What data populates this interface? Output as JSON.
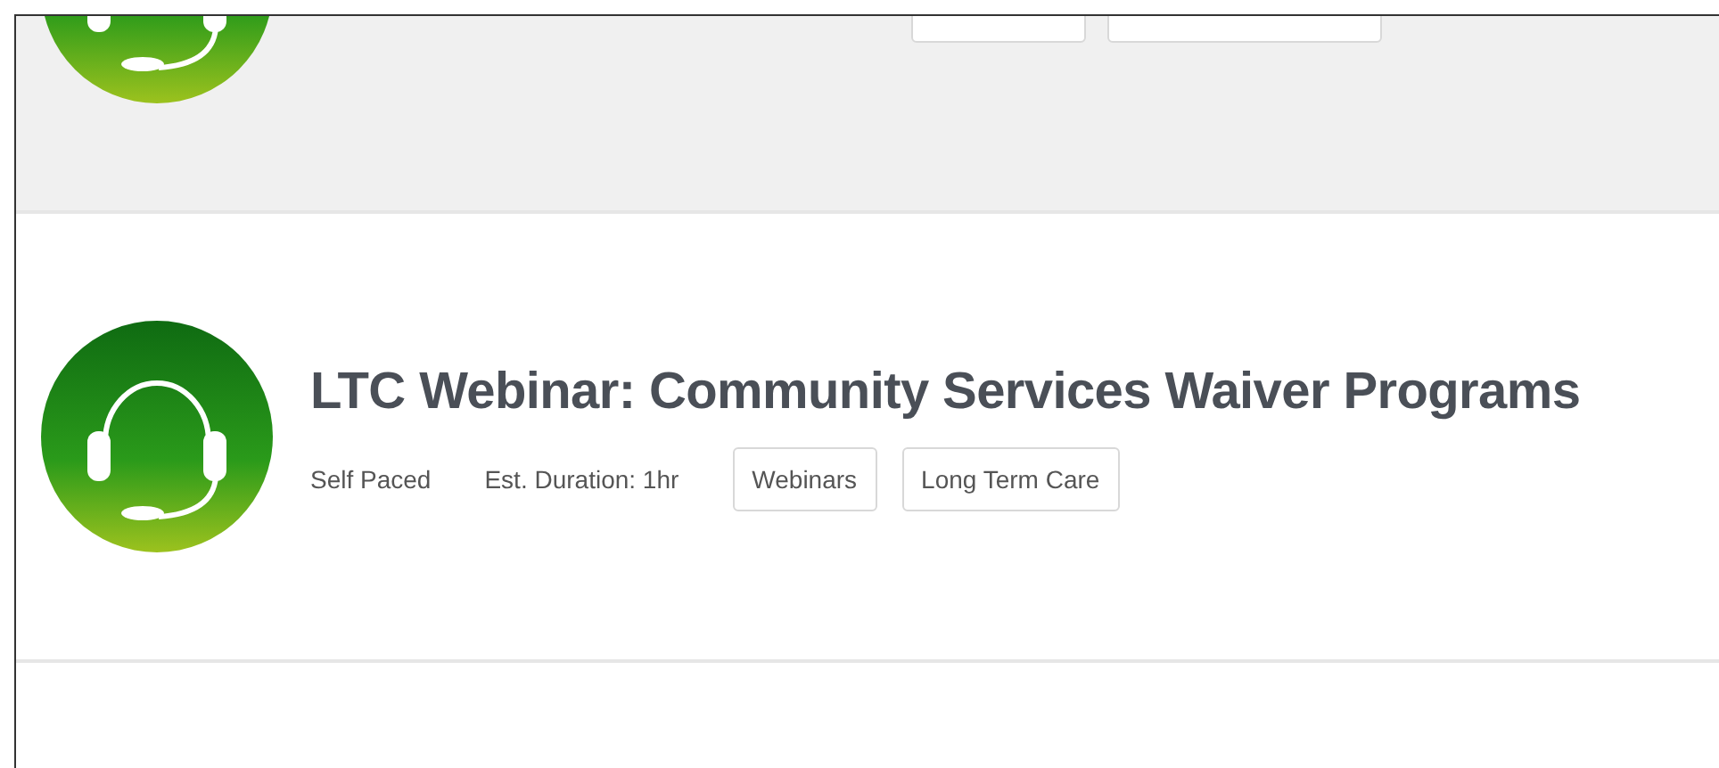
{
  "course": {
    "title": "LTC Webinar: Community Services Waiver Programs",
    "pace": "Self Paced",
    "duration": "Est. Duration: 1hr",
    "tags": [
      "Webinars",
      "Long Term Care"
    ]
  }
}
